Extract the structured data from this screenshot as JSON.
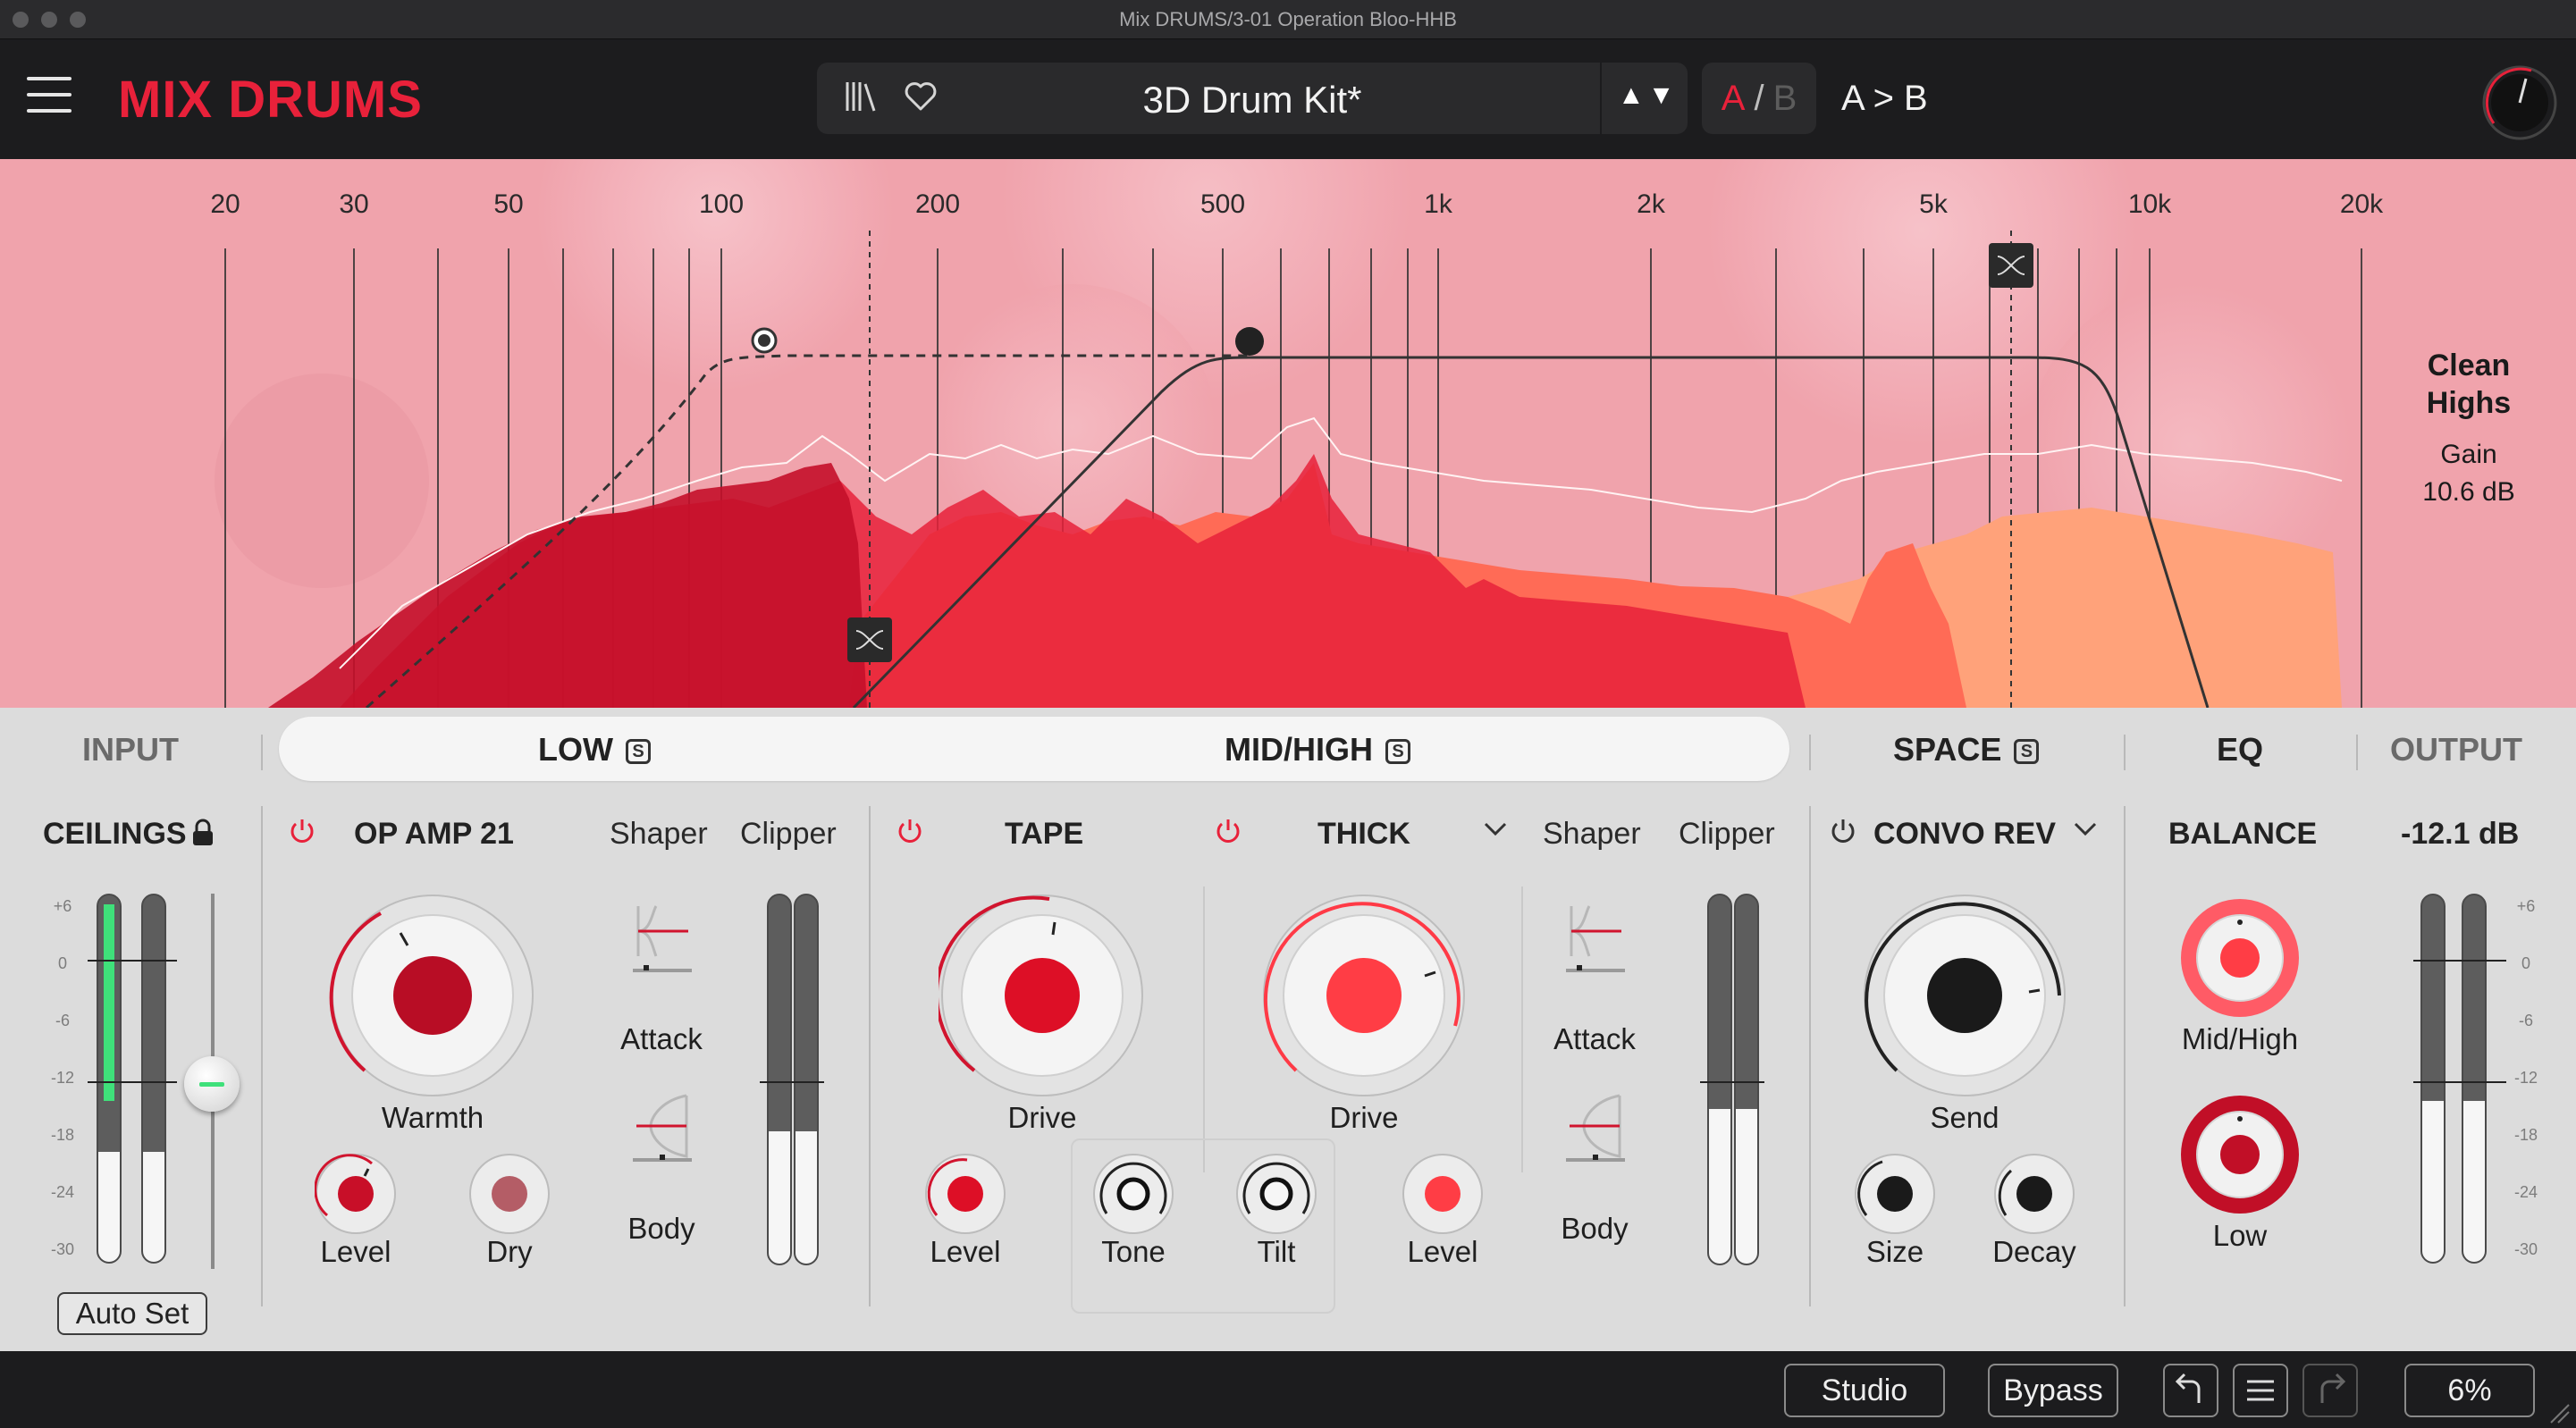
{
  "window": {
    "title": "Mix DRUMS/3-01 Operation Bloo-HHB"
  },
  "header": {
    "brand": "MIX DRUMS",
    "preset_name": "3D Drum Kit*",
    "ab_a": "A",
    "ab_slash": "/",
    "ab_b": "B",
    "a_to_b": "A > B",
    "arrows": "▲▼"
  },
  "spectrum": {
    "freq_labels": [
      "20",
      "30",
      "50",
      "100",
      "200",
      "500",
      "1k",
      "2k",
      "5k",
      "10k",
      "20k"
    ],
    "band_name_line1": "Clean",
    "band_name_line2": "Highs",
    "gain_label": "Gain",
    "gain_value": "10.6 dB",
    "colors": {
      "background": "#f0a3ac",
      "low_fill": "#d4102e",
      "mid_fill": "#ff6b56",
      "high_fill": "#ffa27a"
    }
  },
  "tabs": {
    "input": "INPUT",
    "low": "LOW",
    "mid_high": "MID/HIGH",
    "space": "SPACE",
    "eq": "EQ",
    "output": "OUTPUT",
    "solo_glyph": "S"
  },
  "input_section": {
    "title": "CEILINGS",
    "auto_set": "Auto Set",
    "scale": [
      "+6",
      "0",
      "-6",
      "-12",
      "-18",
      "-24",
      "-30"
    ]
  },
  "low_section": {
    "module": "OP AMP 21",
    "shaper": "Shaper",
    "clipper": "Clipper",
    "warmth": "Warmth",
    "level": "Level",
    "dry": "Dry",
    "attack": "Attack",
    "body": "Body"
  },
  "mid_section": {
    "tape": "TAPE",
    "thick": "THICK",
    "shaper": "Shaper",
    "clipper": "Clipper",
    "tape_drive": "Drive",
    "thick_drive": "Drive",
    "level_left": "Level",
    "tone": "Tone",
    "tilt": "Tilt",
    "level_right": "Level",
    "attack": "Attack",
    "body": "Body"
  },
  "space_section": {
    "module": "CONVO REV",
    "send": "Send",
    "size": "Size",
    "decay": "Decay"
  },
  "eq_section": {
    "title": "BALANCE",
    "mid_high": "Mid/High",
    "low": "Low"
  },
  "output_section": {
    "value": "-12.1 dB",
    "scale": [
      "+6",
      "0",
      "-6",
      "-12",
      "-18",
      "-24",
      "-30"
    ]
  },
  "footer": {
    "studio": "Studio",
    "bypass": "Bypass",
    "zoom": "6%"
  }
}
